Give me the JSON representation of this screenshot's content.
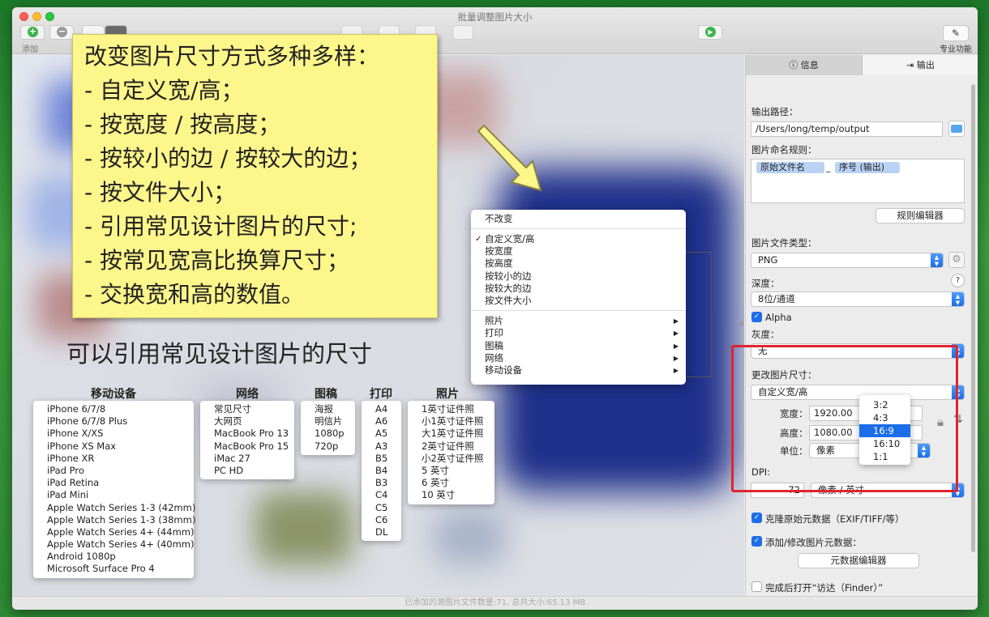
{
  "window": {
    "title": "批量调整图片大小"
  },
  "toolbar": {
    "add_label": "添加",
    "pro_label": "专业功能"
  },
  "statusbar": {
    "text": "已添加的源图片文件数量:71, 总共大小:65.13 MB"
  },
  "sticky_note": {
    "lines": [
      "改变图片尺寸方式多种多样：",
      "- 自定义宽/高；",
      "- 按宽度 / 按高度；",
      "- 按较小的边 / 按较大的边；",
      "- 按文件大小；",
      "- 引用常见设计图片的尺寸;",
      "- 按常见宽高比换算尺寸；",
      "- 交换宽和高的数值。"
    ]
  },
  "caption": "可以引用常见设计图片的尺寸",
  "presets": {
    "mobile": {
      "title": "移动设备",
      "items": [
        "iPhone 6/7/8",
        "iPhone 6/7/8 Plus",
        "iPhone X/XS",
        "iPhone XS Max",
        "iPhone XR",
        "iPad Pro",
        "iPad Retina",
        "iPad Mini",
        "Apple Watch Series 1-3 (42mm)",
        "Apple Watch Series 1-3 (38mm)",
        "Apple Watch Series 4+ (44mm)",
        "Apple Watch Series 4+ (40mm)",
        "Android 1080p",
        "Microsoft Surface Pro 4"
      ]
    },
    "web": {
      "title": "网络",
      "items": [
        "常见尺寸",
        "大网页",
        "MacBook Pro 13",
        "MacBook Pro 15",
        "iMac 27",
        "PC HD"
      ]
    },
    "draft": {
      "title": "图稿",
      "items": [
        "海报",
        "明信片",
        "1080p",
        "720p"
      ]
    },
    "print": {
      "title": "打印",
      "items": [
        "A4",
        "A6",
        "A5",
        "A3",
        "B5",
        "B4",
        "B3",
        "C4",
        "C5",
        "C6",
        "DL"
      ]
    },
    "photo": {
      "title": "照片",
      "items": [
        "1英寸证件照",
        "小1英寸证件照",
        "大1英寸证件照",
        "2英寸证件照",
        "小2英寸证件照",
        "5 英寸",
        "6 英寸",
        "10 英寸"
      ]
    }
  },
  "resize_menu": {
    "no_change": "不改变",
    "modes": [
      "自定义宽/高",
      "按宽度",
      "按高度",
      "按较小的边",
      "按较大的边",
      "按文件大小"
    ],
    "checked": "✓",
    "submenus": [
      "照片",
      "打印",
      "图稿",
      "网络",
      "移动设备"
    ]
  },
  "panel": {
    "tabs": {
      "info": "信息",
      "output": "输出"
    },
    "output_path_label": "输出路径：",
    "output_path": "/Users/long/temp/output",
    "naming_label": "图片命名规则：",
    "naming_tokens": [
      "原始文件名",
      "序号 (输出)"
    ],
    "naming_sep": "_",
    "rule_editor_button": "规则编辑器",
    "file_type_label": "图片文件类型：",
    "file_type": "PNG",
    "depth_label": "深度：",
    "depth": "8位/通道",
    "alpha_label": "Alpha",
    "gray_label": "灰度：",
    "gray": "无",
    "resize_label": "更改图片尺寸：",
    "resize_mode": "自定义宽/高",
    "width_label": "宽度：",
    "width": "1920.00",
    "height_label": "高度：",
    "height": "1080.00",
    "unit_label": "单位：",
    "unit": "像素",
    "dpi_label": "DPI:",
    "dpi": "72",
    "dpi_unit": "像素 / 英寸",
    "ratios": [
      "3:2",
      "4:3",
      "16:9",
      "16:10",
      "1:1"
    ],
    "ratio_selected": "16:9",
    "clone_meta_label": "克隆原始元数据（EXIF/TIFF/等）",
    "add_meta_label": "添加/修改图片元数据：",
    "meta_editor_button": "元数据编辑器",
    "open_finder_label": "完成后打开“访达（Finder）”",
    "help": "?"
  }
}
